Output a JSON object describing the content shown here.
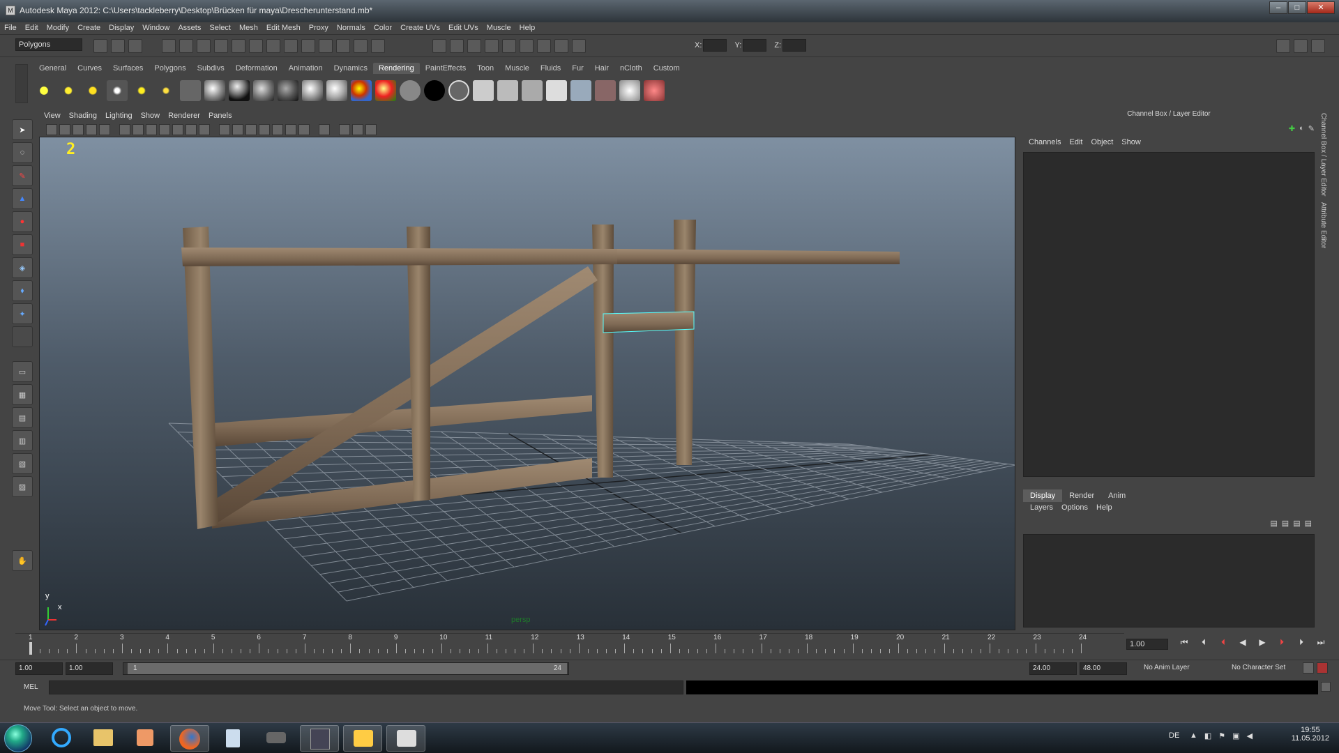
{
  "window": {
    "title": "Autodesk Maya 2012: C:\\Users\\tackleberry\\Desktop\\Brücken für maya\\Drescherunterstand.mb*",
    "app_icon": "maya-icon"
  },
  "menubar": [
    "File",
    "Edit",
    "Modify",
    "Create",
    "Display",
    "Window",
    "Assets",
    "Select",
    "Mesh",
    "Edit Mesh",
    "Proxy",
    "Normals",
    "Color",
    "Create UVs",
    "Edit UVs",
    "Muscle",
    "Help"
  ],
  "status": {
    "mode": "Polygons",
    "x_label": "X:",
    "y_label": "Y:",
    "z_label": "Z:"
  },
  "shelf": {
    "tabs": [
      "General",
      "Curves",
      "Surfaces",
      "Polygons",
      "Subdivs",
      "Deformation",
      "Animation",
      "Dynamics",
      "Rendering",
      "PaintEffects",
      "Toon",
      "Muscle",
      "Fluids",
      "Fur",
      "Hair",
      "nCloth",
      "Custom"
    ],
    "active": "Rendering"
  },
  "viewport": {
    "menu": [
      "View",
      "Shading",
      "Lighting",
      "Show",
      "Renderer",
      "Panels"
    ],
    "camera": "persp",
    "number": "2",
    "axis_y": "y",
    "axis_x": "x"
  },
  "channel_box": {
    "title": "Channel Box / Layer Editor",
    "menu": [
      "Channels",
      "Edit",
      "Object",
      "Show"
    ]
  },
  "layer_editor": {
    "tabs": [
      "Display",
      "Render",
      "Anim"
    ],
    "active": "Display",
    "menu": [
      "Layers",
      "Options",
      "Help"
    ]
  },
  "side_tabs": [
    "Channel Box / Layer Editor",
    "Attribute Editor"
  ],
  "timeline": {
    "ticks": [
      "1",
      "2",
      "3",
      "4",
      "5",
      "6",
      "7",
      "8",
      "9",
      "10",
      "11",
      "12",
      "13",
      "14",
      "15",
      "16",
      "17",
      "18",
      "19",
      "20",
      "21",
      "22",
      "23",
      "24"
    ],
    "current": "1.00"
  },
  "range": {
    "start": "1.00",
    "start2": "1.00",
    "slider_start": "1",
    "slider_end": "24",
    "end": "24.00",
    "end2": "48.00",
    "anim_layer": "No Anim Layer",
    "char_set": "No Character Set"
  },
  "command": {
    "label": "MEL"
  },
  "help_line": "Move Tool: Select an object to move.",
  "taskbar": {
    "lang": "DE",
    "time": "19:55",
    "date": "11.05.2012"
  }
}
